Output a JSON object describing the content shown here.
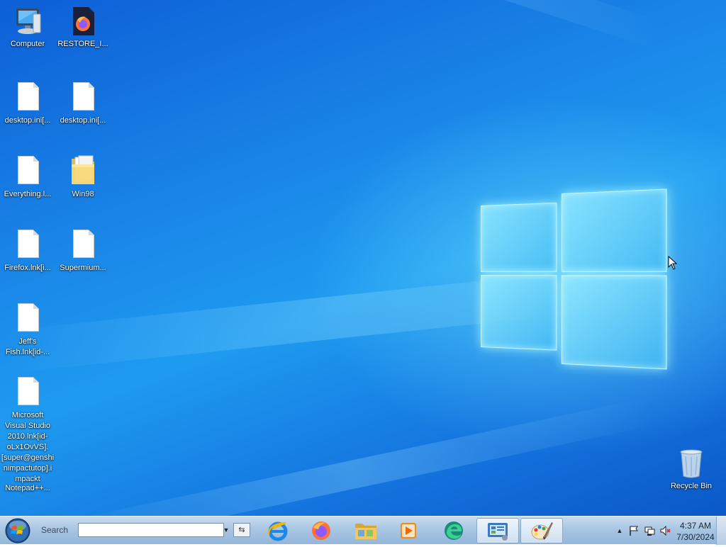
{
  "desktop": {
    "icons": [
      {
        "label": "Computer",
        "type": "computer"
      },
      {
        "label": "RESTORE_I...",
        "type": "firefox-file"
      },
      {
        "label": "desktop.ini[...",
        "type": "document"
      },
      {
        "label": "desktop.ini[...",
        "type": "document"
      },
      {
        "label": "Everything.l...",
        "type": "document"
      },
      {
        "label": "Win98",
        "type": "folder"
      },
      {
        "label": "Firefox.lnk[i...",
        "type": "document"
      },
      {
        "label": "Supermium...",
        "type": "document"
      },
      {
        "label": "Jeff's Fish.lnk[id-...",
        "type": "document"
      },
      {
        "label": "Microsoft Visual Studio 2010.lnk[id-oLx1OvVS].[super@genshinimpactutop].impackt",
        "type": "document"
      },
      {
        "label": "Notepad++...",
        "type": "document"
      },
      {
        "label": "Recycle Bin",
        "type": "recycle-bin"
      }
    ]
  },
  "taskbar": {
    "search_label": "Search",
    "search_value": "",
    "pinned": [
      {
        "name": "internet-explorer",
        "active": false
      },
      {
        "name": "firefox",
        "active": false
      },
      {
        "name": "file-explorer",
        "active": false
      },
      {
        "name": "media-player",
        "active": false
      },
      {
        "name": "edge",
        "active": false
      },
      {
        "name": "control-panel",
        "active": true
      },
      {
        "name": "paint",
        "active": true
      }
    ],
    "tray": {
      "icons": [
        "show-hidden-icons",
        "action-center-flag-icon",
        "network-icon",
        "volume-muted-icon"
      ],
      "time": "4:37 AM",
      "date": "7/30/2024"
    }
  },
  "colors": {
    "desktop_blue": "#1a86e8",
    "taskbar": "#a9c6e3",
    "logo_glow": "#9beaff"
  }
}
